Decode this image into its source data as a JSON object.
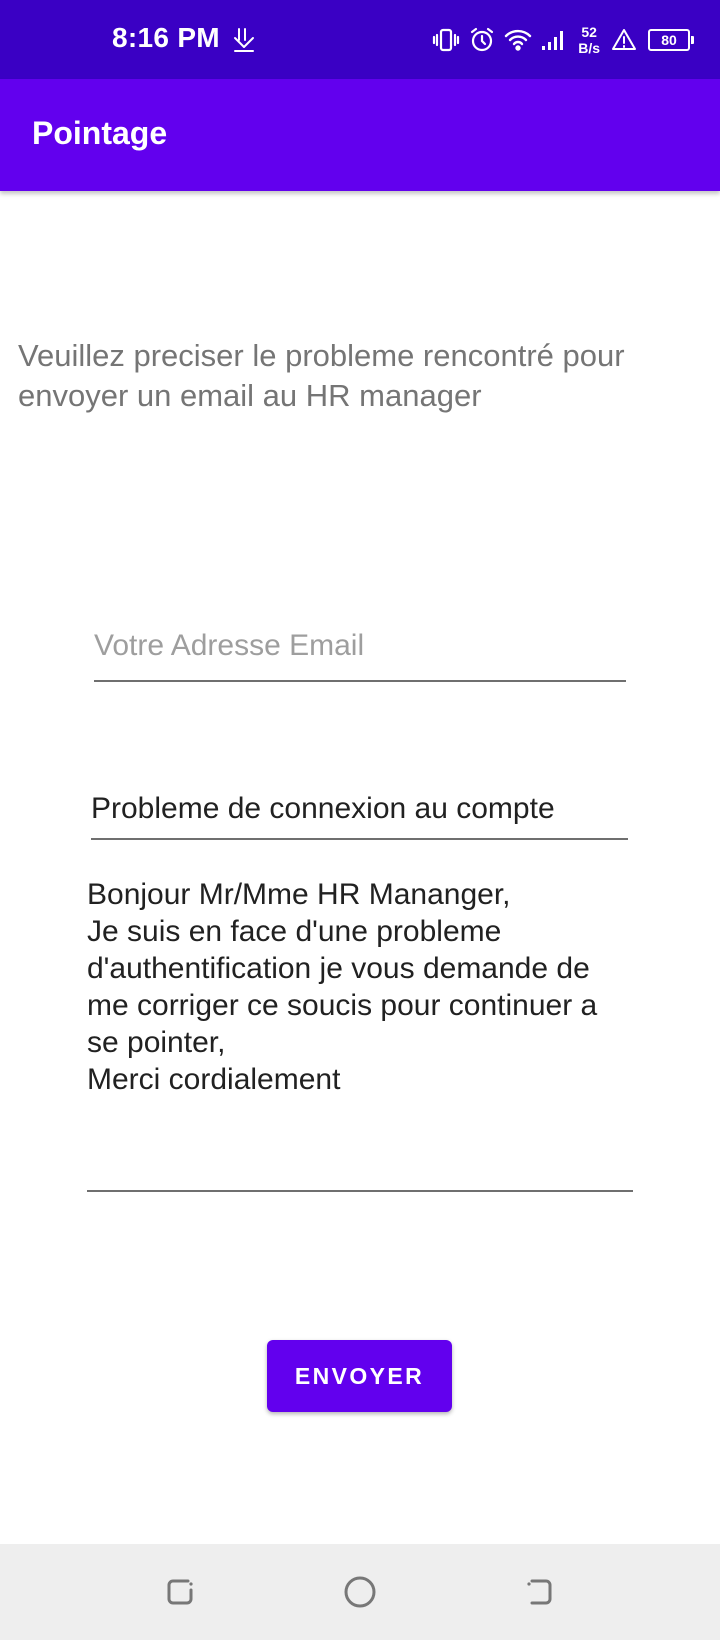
{
  "status_bar": {
    "time": "8:16 PM",
    "net_speed_value": "52",
    "net_speed_unit": "B/s",
    "battery_level": "80",
    "icons": [
      "download-icon",
      "vibrate-icon",
      "alarm-icon",
      "wifi-icon",
      "signal-icon",
      "alert-icon",
      "battery-icon"
    ]
  },
  "app_bar": {
    "title": "Pointage"
  },
  "form": {
    "instruction": "Veuillez preciser le probleme rencontré pour envoyer un email au HR manager",
    "email_placeholder": "Votre Adresse Email",
    "email_value": "",
    "subject_value": "Probleme de connexion au compte",
    "message_value": "Bonjour Mr/Mme HR Mananger,\nJe suis en face d'une probleme d'authentification je vous demande de me corriger ce soucis pour continuer a se pointer,\nMerci cordialement",
    "send_label": "ENVOYER"
  },
  "nav_bar": {
    "icons": [
      "recent-apps-icon",
      "home-icon",
      "back-icon"
    ]
  },
  "colors": {
    "status_bar": "#3A00C4",
    "primary": "#6200EE",
    "instruction_text": "#757575",
    "nav_bar": "#EEEEEE"
  }
}
